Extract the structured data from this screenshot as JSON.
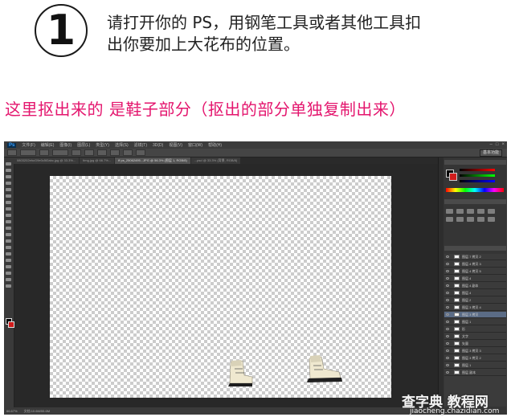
{
  "step": {
    "number": "1",
    "instruction_line1": "请打开你的 PS，用钢笔工具或者其他工具扣",
    "instruction_line2": "出你要加上大花布的位置。"
  },
  "caption": "这里抠出来的 是鞋子部分（抠出的部分单独复制出来）",
  "photoshop": {
    "logo": "Ps",
    "menu": [
      "文件(F)",
      "编辑(E)",
      "图像(I)",
      "图层(L)",
      "类型(Y)",
      "选择(S)",
      "滤镜(T)",
      "3D(D)",
      "视图(V)",
      "窗口(W)",
      "帮助(H)"
    ],
    "workspace": "基本功能",
    "tabs": [
      "0803202ehcG9e0c5f2abc.jpg @ 33.3%...",
      "timg.jpg @ 66.7%...",
      "ff ps_25062495...JPG @ 56.3% (图层 1, RGB/8)",
      "...psd @ 33.3% (背景, RGB/8)"
    ],
    "status": {
      "zoom": "66.67%",
      "doc": "文档:10.6M/55.6M"
    },
    "layers": [
      "图层 7 拷贝 2",
      "图层 4 拷贝 3",
      "图层 4 拷贝 5",
      "图层 4",
      "图层 4 副本",
      "图层 4",
      "图层 2",
      "图层 3 拷贝 4",
      "图层 3 拷贝",
      "图层 1",
      "形",
      "文字",
      "矢量",
      "图层 3 拷贝 3",
      "图层 3 拷贝 2",
      "图层 1",
      "图层 副本"
    ],
    "selected_layer_index": 8
  },
  "watermark": {
    "main": "查字典 教程网",
    "url": "jiaocheng.chazidian.com"
  }
}
